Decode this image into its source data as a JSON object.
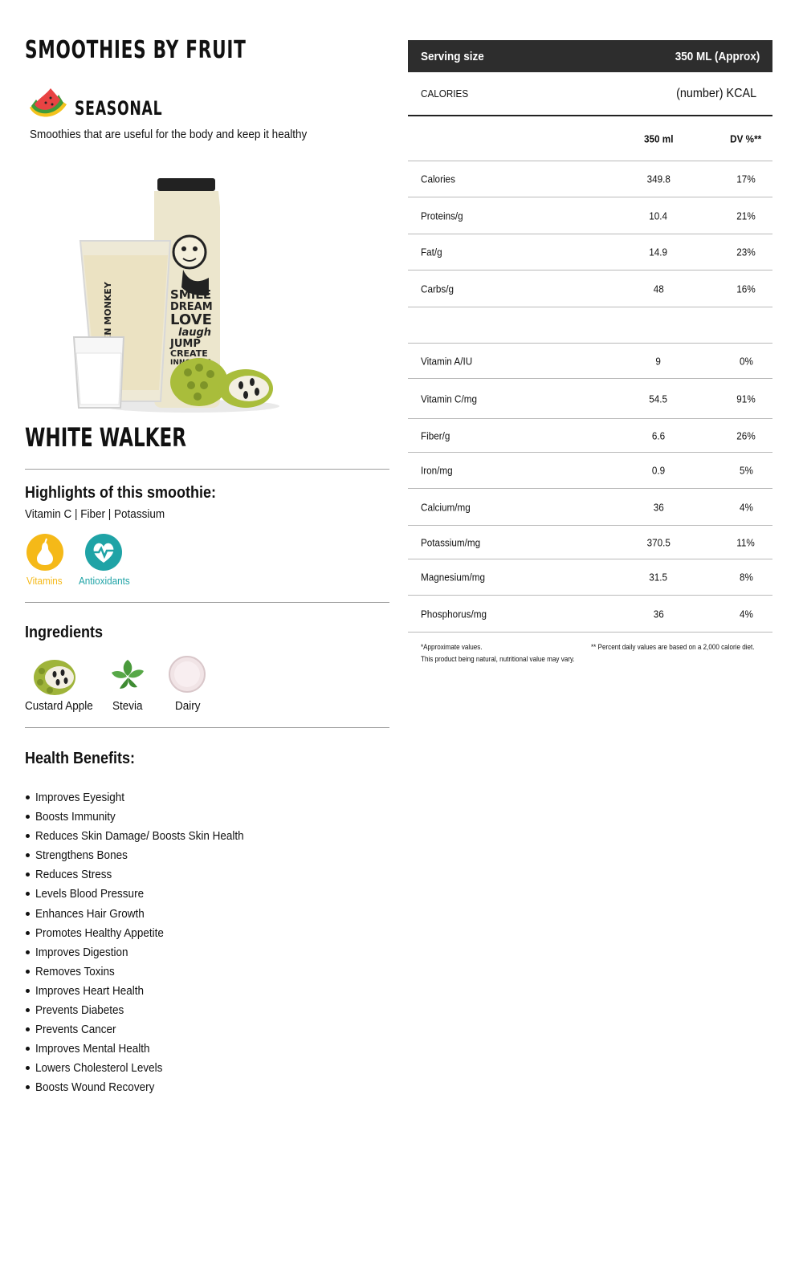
{
  "header": {
    "title": "SMOOTHIES BY FRUIT"
  },
  "category": {
    "label": "SEASONAL",
    "icon": "watermelon-icon",
    "description": "Smoothies that are useful for the body and keep it healthy"
  },
  "product": {
    "name": "WHITE WALKER",
    "bottle_text": [
      "SMILE",
      "DREAM",
      "LOVE",
      "laugh",
      "JUMP",
      "CREATE",
      "INNOVATE"
    ],
    "glass_text": "NKEN MONKEY"
  },
  "highlights": {
    "title": "Highlights of this smoothie:",
    "list": "Vitamin C | Fiber | Potassium",
    "badges": [
      {
        "label": "Vitamins",
        "icon": "pear-icon",
        "color": "#f5b918"
      },
      {
        "label": "Antioxidants",
        "icon": "heartbeat-icon",
        "color": "#1fa3a6"
      }
    ]
  },
  "ingredients": {
    "title": "Ingredients",
    "items": [
      {
        "label": "Custard Apple",
        "icon": "custard-apple-icon"
      },
      {
        "label": "Stevia",
        "icon": "stevia-leaf-icon"
      },
      {
        "label": "Dairy",
        "icon": "milk-bowl-icon"
      }
    ]
  },
  "benefits": {
    "title": "Health Benefits:",
    "items": [
      "Improves Eyesight",
      "Boosts Immunity",
      "Reduces Skin Damage/ Boosts Skin Health",
      "Strengthens Bones",
      "Reduces Stress",
      "Levels Blood Pressure",
      "Enhances Hair Growth",
      "Promotes Healthy Appetite",
      "Improves Digestion",
      "Removes Toxins",
      "Improves Heart Health",
      "Prevents Diabetes",
      "Prevents Cancer",
      "Improves Mental Health",
      "Lowers Cholesterol Levels",
      "Boosts Wound Recovery"
    ]
  },
  "nutrition": {
    "serving_label": "Serving size",
    "serving_value": "350 ML (Approx)",
    "calories_label": "CALORIES",
    "calories_value": "(number) KCAL",
    "col_amount": "350 ml",
    "col_dv": "DV %**",
    "rows": [
      {
        "name": "Calories",
        "amount": "349.8",
        "dv": "17%"
      },
      {
        "name": "Proteins/g",
        "amount": "10.4",
        "dv": "21%"
      },
      {
        "name": "Fat/g",
        "amount": "14.9",
        "dv": "23%"
      },
      {
        "name": "Carbs/g",
        "amount": "48",
        "dv": "16%"
      },
      {
        "name": "",
        "amount": "",
        "dv": ""
      },
      {
        "name": "Vitamin A/IU",
        "amount": "9",
        "dv": "0%"
      },
      {
        "name": "Vitamin C/mg",
        "amount": "54.5",
        "dv": "91%"
      },
      {
        "name": "Fiber/g",
        "amount": "6.6",
        "dv": "26%"
      },
      {
        "name": "Iron/mg",
        "amount": "0.9",
        "dv": "5%"
      },
      {
        "name": "Calcium/mg",
        "amount": "36",
        "dv": "4%"
      },
      {
        "name": "Potassium/mg",
        "amount": "370.5",
        "dv": "11%"
      },
      {
        "name": "Magnesium/mg",
        "amount": "31.5",
        "dv": "8%"
      },
      {
        "name": "Phosphorus/mg",
        "amount": "36",
        "dv": "4%"
      }
    ],
    "footnote_left_1": "*Approximate values.",
    "footnote_left_2": "This product being natural, nutritional value may vary.",
    "footnote_right": "** Percent daily values are based on a 2,000 calorie diet."
  }
}
